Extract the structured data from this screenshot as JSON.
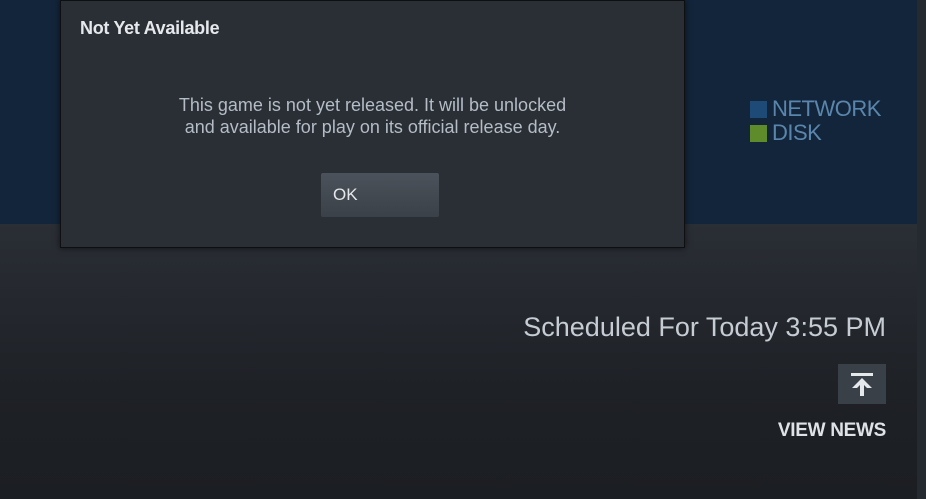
{
  "dialog": {
    "title": "Not Yet Available",
    "message_line1": "This game is not yet released. It will be unlocked",
    "message_line2": "and available for play on its official release day.",
    "ok_label": "OK"
  },
  "legend": {
    "items": [
      {
        "label": "NETWORK",
        "color": "#1e4a77"
      },
      {
        "label": "DISK",
        "color": "#5e8c2a"
      }
    ]
  },
  "update": {
    "scheduled_text": "Scheduled For Today 3:55 PM",
    "news_icon": "arrow-up-to-line-icon",
    "view_news_label": "VIEW NEWS"
  },
  "colors": {
    "graph_background": "#13253a",
    "panel_background": "#1c1f24",
    "dialog_background": "#2a2e35"
  }
}
